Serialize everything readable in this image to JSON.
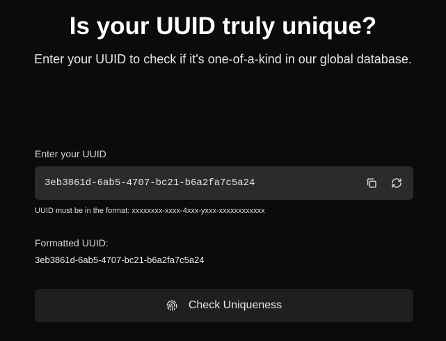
{
  "header": {
    "title": "Is your UUID truly unique?",
    "subtitle": "Enter your UUID to check if it's one-of-a-kind in our global database."
  },
  "uuid_field": {
    "label": "Enter your UUID",
    "value": "3eb3861d-6ab5-4707-bc21-b6a2fa7c5a24",
    "copy_icon": "copy-icon",
    "refresh_icon": "refresh-icon",
    "hint": "UUID must be in the format: xxxxxxxx-xxxx-4xxx-yxxx-xxxxxxxxxxxx"
  },
  "formatted": {
    "label": "Formatted UUID:",
    "value": "3eb3861d-6ab5-4707-bc21-b6a2fa7c5a24"
  },
  "action": {
    "label": "Check Uniqueness",
    "icon": "fingerprint-icon"
  },
  "colors": {
    "background": "#0b0b0c",
    "input_background": "#2b2b2c",
    "button_background": "#1f1f21",
    "text": "#ffffff"
  }
}
